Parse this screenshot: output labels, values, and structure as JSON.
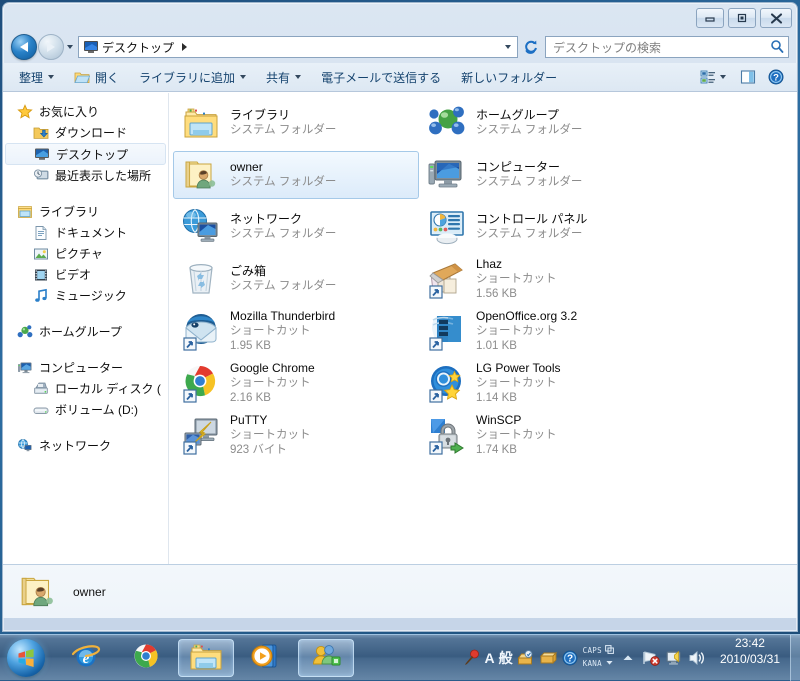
{
  "window": {
    "controls": [
      {
        "name": "minimize",
        "label": "最小化"
      },
      {
        "name": "maximize",
        "label": "最大化"
      },
      {
        "name": "close",
        "label": "閉じる"
      }
    ]
  },
  "addressbar": {
    "back_label": "戻る",
    "forward_label": "進む",
    "history_label": "最近表示した場所",
    "crumb": "デスクトップ",
    "crumb_icon": "desktop-icon",
    "dropdown_label": "以前の場所",
    "refresh_label": "最新の情報に更新",
    "search_placeholder": "デスクトップの検索",
    "search_value": ""
  },
  "toolbar": {
    "items": [
      {
        "label": "整理",
        "icon": "",
        "caret": true
      },
      {
        "label": "開く",
        "icon": "folder-open-icon",
        "caret": false
      },
      {
        "label": "ライブラリに追加",
        "icon": "",
        "caret": true
      },
      {
        "label": "共有",
        "icon": "",
        "caret": true
      },
      {
        "label": "電子メールで送信する",
        "icon": "",
        "caret": false
      },
      {
        "label": "新しいフォルダー",
        "icon": "",
        "caret": false
      }
    ],
    "views_label": "表示方法の変更",
    "views_icon": "view-list-icon",
    "preview_label": "プレビュー ウィンドウの表示",
    "preview_icon": "preview-pane-icon",
    "help_label": "ヘルプ",
    "help_icon": "help-icon"
  },
  "navpane": {
    "groups": [
      {
        "header": {
          "label": "お気に入り",
          "icon": "star-icon"
        },
        "items": [
          {
            "label": "ダウンロード",
            "icon": "downloads-folder-icon",
            "selected": false
          },
          {
            "label": "デスクトップ",
            "icon": "desktop-icon",
            "selected": true
          },
          {
            "label": "最近表示した場所",
            "icon": "recent-places-icon",
            "selected": false
          }
        ]
      },
      {
        "header": {
          "label": "ライブラリ",
          "icon": "library-icon"
        },
        "items": [
          {
            "label": "ドキュメント",
            "icon": "documents-icon",
            "selected": false
          },
          {
            "label": "ピクチャ",
            "icon": "pictures-icon",
            "selected": false
          },
          {
            "label": "ビデオ",
            "icon": "videos-icon",
            "selected": false
          },
          {
            "label": "ミュージック",
            "icon": "music-icon",
            "selected": false
          }
        ]
      },
      {
        "header": {
          "label": "ホームグループ",
          "icon": "homegroup-icon"
        },
        "items": []
      },
      {
        "header": {
          "label": "コンピューター",
          "icon": "computer-icon"
        },
        "items": [
          {
            "label": "ローカル ディスク (",
            "icon": "local-disk-icon",
            "selected": false
          },
          {
            "label": "ボリューム (D:)",
            "icon": "volume-drive-icon",
            "selected": false
          }
        ]
      },
      {
        "header": {
          "label": "ネットワーク",
          "icon": "network-icon"
        },
        "items": []
      }
    ]
  },
  "filelist": {
    "items": [
      {
        "name": "ライブラリ",
        "type": "システム フォルダー",
        "size": "",
        "icon": "libraries-icon",
        "shortcut": false,
        "selected": false
      },
      {
        "name": "ホームグループ",
        "type": "システム フォルダー",
        "size": "",
        "icon": "homegroup-icon",
        "shortcut": false,
        "selected": false
      },
      {
        "name": "owner",
        "type": "システム フォルダー",
        "size": "",
        "icon": "user-folder-icon",
        "shortcut": false,
        "selected": true
      },
      {
        "name": "コンピューター",
        "type": "システム フォルダー",
        "size": "",
        "icon": "computer-icon",
        "shortcut": false,
        "selected": false
      },
      {
        "name": "ネットワーク",
        "type": "システム フォルダー",
        "size": "",
        "icon": "network-icon",
        "shortcut": false,
        "selected": false
      },
      {
        "name": "コントロール パネル",
        "type": "システム フォルダー",
        "size": "",
        "icon": "control-panel-icon",
        "shortcut": false,
        "selected": false
      },
      {
        "name": "ごみ箱",
        "type": "システム フォルダー",
        "size": "",
        "icon": "recycle-bin-icon",
        "shortcut": false,
        "selected": false
      },
      {
        "name": "Lhaz",
        "type": "ショートカット",
        "size": "1.56 KB",
        "icon": "lhaz-icon",
        "shortcut": true,
        "selected": false
      },
      {
        "name": "Mozilla Thunderbird",
        "type": "ショートカット",
        "size": "1.95 KB",
        "icon": "thunderbird-icon",
        "shortcut": true,
        "selected": false
      },
      {
        "name": "OpenOffice.org 3.2",
        "type": "ショートカット",
        "size": "1.01 KB",
        "icon": "openoffice-icon",
        "shortcut": true,
        "selected": false
      },
      {
        "name": "Google Chrome",
        "type": "ショートカット",
        "size": "2.16 KB",
        "icon": "chrome-icon",
        "shortcut": true,
        "selected": false
      },
      {
        "name": "LG Power Tools",
        "type": "ショートカット",
        "size": "1.14 KB",
        "icon": "lg-power-tools-icon",
        "shortcut": true,
        "selected": false
      },
      {
        "name": "PuTTY",
        "type": "ショートカット",
        "size": "923 バイト",
        "icon": "putty-icon",
        "shortcut": true,
        "selected": false
      },
      {
        "name": "WinSCP",
        "type": "ショートカット",
        "size": "1.74 KB",
        "icon": "winscp-icon",
        "shortcut": true,
        "selected": false
      }
    ]
  },
  "details": {
    "name": "owner",
    "icon": "user-folder-icon"
  },
  "taskbar": {
    "start_label": "スタート",
    "buttons": [
      {
        "label": "Internet Explorer",
        "icon": "ie-icon",
        "active": false
      },
      {
        "label": "Google Chrome",
        "icon": "chrome-icon",
        "active": false
      },
      {
        "label": "エクスプローラー",
        "icon": "explorer-icon",
        "active": true
      },
      {
        "label": "Windows Media Player",
        "icon": "wmp-icon",
        "active": false
      },
      {
        "label": "ホームグループ",
        "icon": "people-icon",
        "active": true
      }
    ],
    "tray": {
      "ime": {
        "mode_icon": "ime-pen-icon",
        "input_mode": "A",
        "conversion_mode": "般",
        "tool_icon": "ime-tools-icon",
        "pad_icon": "ime-pad-icon",
        "help_icon": "ime-help-icon",
        "caps_label": "CAPS",
        "kana_label": "KANA",
        "layout_icon": "ime-layout-icon",
        "options_caret": "▾"
      },
      "overflow_label": "隠れているインジケーターを表示します",
      "icons": [
        {
          "name": "network-error-icon",
          "label": "ネットワーク"
        },
        {
          "name": "action-center-icon",
          "label": "アクション センター"
        },
        {
          "name": "volume-icon",
          "label": "音量"
        }
      ]
    },
    "clock": {
      "time": "23:42",
      "date": "2010/03/31"
    },
    "show_desktop_label": "デスクトップの表示"
  }
}
